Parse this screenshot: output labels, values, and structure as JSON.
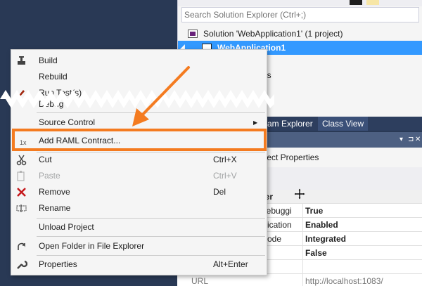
{
  "solution_explorer": {
    "search_placeholder": "Search Solution Explorer (Ctrl+;)",
    "solution_label": "Solution 'WebApplication1' (1 project)",
    "project_label": "WebApplication1",
    "child_fragments": [
      "s",
      "es",
      "f"
    ]
  },
  "tabs": [
    "am Explorer",
    "Class View"
  ],
  "properties": {
    "title_glyphs": [
      "▾",
      "⊐",
      "✕"
    ],
    "object_label": "oject Properties",
    "category": "ver",
    "rows": [
      {
        "name": "Debuggi",
        "value": "True"
      },
      {
        "name": "ntication",
        "value": "Enabled"
      },
      {
        "name": "Mode",
        "value": "Integrated"
      },
      {
        "name": "",
        "value": "False"
      },
      {
        "name": "",
        "value": ""
      },
      {
        "name": "URL",
        "value": "http://localhost:1083/"
      }
    ]
  },
  "context_menu": {
    "items": [
      {
        "label": "Build",
        "shortcut": "",
        "icon": "build-icon"
      },
      {
        "label": "Rebuild",
        "shortcut": "",
        "icon": ""
      },
      {
        "label": "Run Test(s)",
        "shortcut": "",
        "icon": "run-test-icon"
      },
      {
        "label": "Debug",
        "shortcut": "",
        "icon": ""
      },
      {
        "label": "Source Control",
        "shortcut": "",
        "icon": ""
      },
      {
        "label": "Add RAML Contract...",
        "shortcut": "",
        "icon": "raml-icon"
      },
      {
        "label": "Cut",
        "shortcut": "Ctrl+X",
        "icon": "scissors-icon"
      },
      {
        "label": "Paste",
        "shortcut": "Ctrl+V",
        "icon": "paste-icon"
      },
      {
        "label": "Remove",
        "shortcut": "Del",
        "icon": "remove-x-icon"
      },
      {
        "label": "Rename",
        "shortcut": "",
        "icon": "rename-icon"
      },
      {
        "label": "Unload Project",
        "shortcut": "",
        "icon": ""
      },
      {
        "label": "Open Folder in File Explorer",
        "shortcut": "",
        "icon": "open-folder-icon"
      },
      {
        "label": "Properties",
        "shortcut": "Alt+Enter",
        "icon": "wrench-icon"
      }
    ],
    "raml_icon_text": "1x"
  },
  "colors": {
    "ide_background": "#293955",
    "highlight": "#f47b20",
    "selection": "#3399ff",
    "remove_icon": "#c5171a"
  }
}
